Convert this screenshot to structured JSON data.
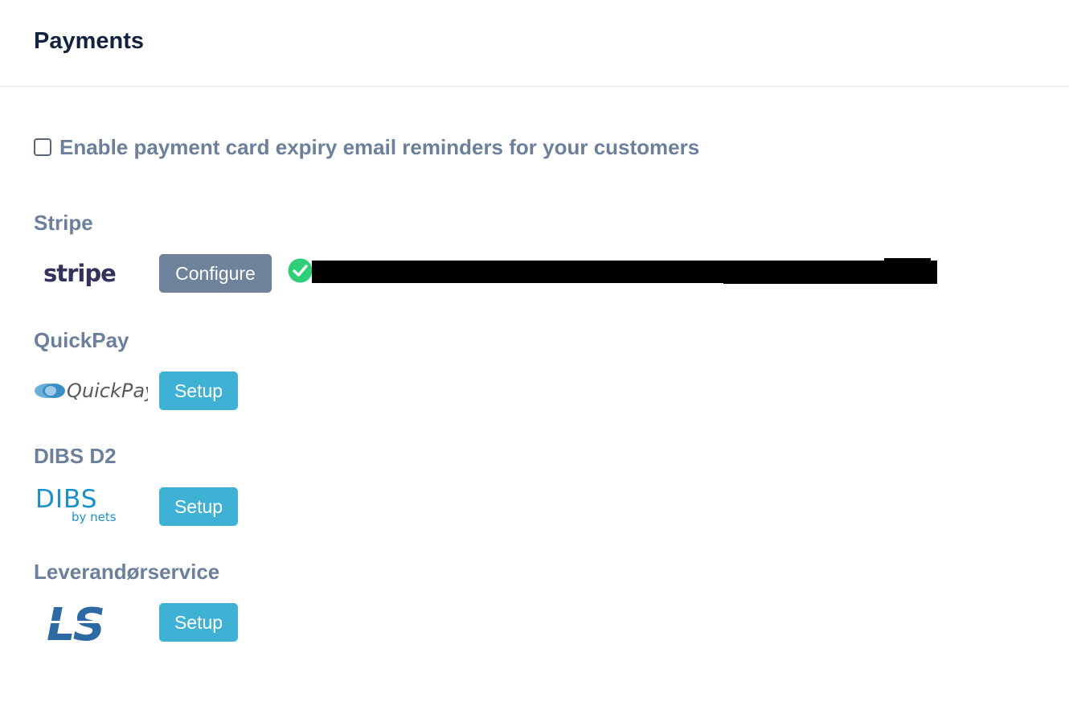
{
  "page": {
    "title": "Payments"
  },
  "reminder": {
    "checked": false,
    "label": "Enable payment card expiry email reminders for your customers"
  },
  "providers": [
    {
      "title": "Stripe",
      "logo_text": "stripe",
      "button_label": "Configure",
      "connected": true,
      "status_color": "#2fce79"
    },
    {
      "title": "QuickPay",
      "logo_text": "QuickPay",
      "button_label": "Setup"
    },
    {
      "title": "DIBS D2",
      "logo_text": "DIBS",
      "logo_subtext": "by nets",
      "button_label": "Setup"
    },
    {
      "title": "Leverandørservice",
      "logo_text": "LS",
      "button_label": "Setup"
    }
  ],
  "colors": {
    "configure_button": "#6f829b",
    "setup_button": "#3fb1d4",
    "section_title": "#6c809c",
    "page_title": "#12233f"
  }
}
